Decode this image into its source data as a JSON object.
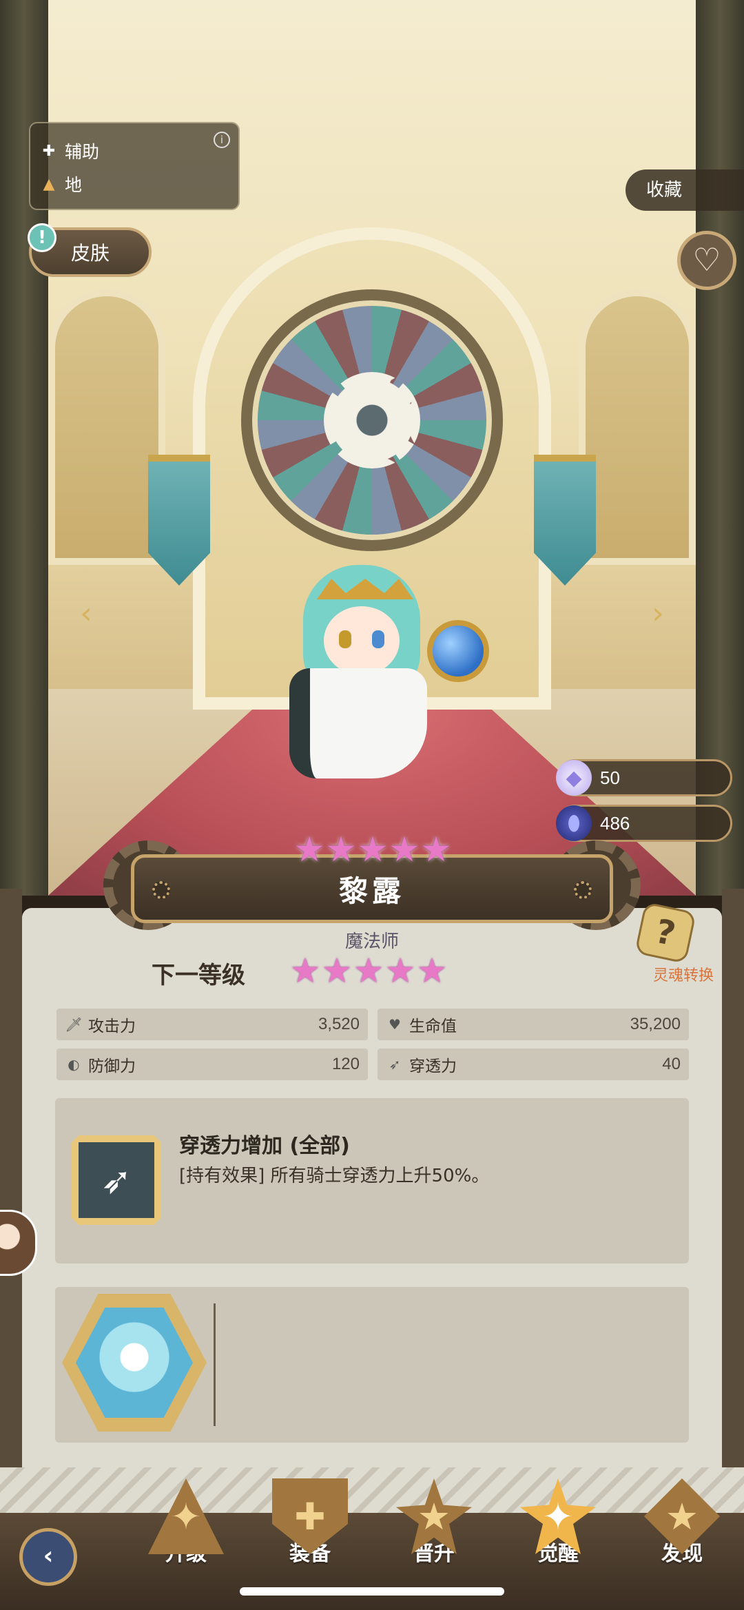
{
  "hero": {
    "name": "黎露",
    "class": "魔法师",
    "current_stars": 5,
    "next_level_stars": 5,
    "role": "辅助",
    "attribute": "地"
  },
  "top_left": {
    "skin_label": "皮肤",
    "info_icon": "info-icon"
  },
  "top_right": {
    "collect_label": "收藏",
    "heart_icon": "heart-icon"
  },
  "currencies": {
    "crystal": {
      "value": "50",
      "icon": "crystal-icon"
    },
    "soulstone": {
      "value": "486",
      "icon": "soulstone-icon"
    }
  },
  "panel": {
    "next_level_label": "下一等级",
    "soul_convert_label": "灵魂转换",
    "stats": {
      "attack": {
        "label": "攻击力",
        "value": "3,520",
        "icon": "sword-icon"
      },
      "hp": {
        "label": "生命值",
        "value": "35,200",
        "icon": "heart-icon"
      },
      "defense": {
        "label": "防御力",
        "value": "120",
        "icon": "shield-icon"
      },
      "penetration": {
        "label": "穿透力",
        "value": "40",
        "icon": "bow-icon"
      }
    },
    "skill": {
      "title": "穿透力增加 (全部)",
      "description": "[持有效果] 所有骑士穿透力上升50%。",
      "icon": "bow-icon"
    }
  },
  "bottom_nav": {
    "items": [
      {
        "label": "升级",
        "icon": "upgrade-icon",
        "active": false
      },
      {
        "label": "装备",
        "icon": "equip-icon",
        "active": false
      },
      {
        "label": "晋升",
        "icon": "promote-icon",
        "active": false
      },
      {
        "label": "觉醒",
        "icon": "awaken-icon",
        "active": true
      },
      {
        "label": "发现",
        "icon": "discover-icon",
        "active": false
      }
    ],
    "back_icon": "back-arrow-icon"
  },
  "colors": {
    "accent_gold": "#c5a36b",
    "star_pink": "#e879c6",
    "panel_bg": "#dedbd0",
    "soul_convert_text": "#d8743c"
  }
}
